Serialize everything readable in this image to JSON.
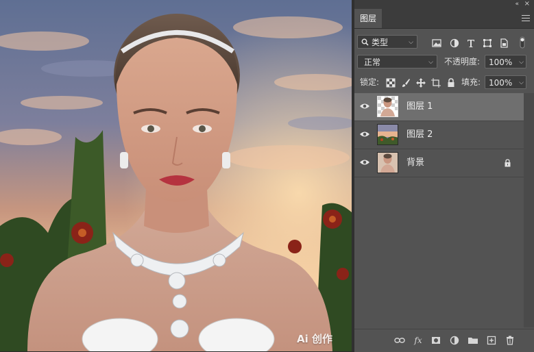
{
  "canvas": {
    "watermark": "Ai 创作"
  },
  "panel": {
    "window_controls": {
      "collapse": "«",
      "close": "×"
    },
    "tab_label": "图层",
    "filter": {
      "search_icon": "search-icon",
      "kind_value": "类型"
    },
    "filter_icons": [
      "image-filter-icon",
      "adjustment-filter-icon",
      "text-filter-icon",
      "shape-filter-icon",
      "smartobject-filter-icon"
    ],
    "blend_mode": "正常",
    "opacity": {
      "label": "不透明度:",
      "value": "100%"
    },
    "lock": {
      "label": "锁定:",
      "icons": [
        "lock-transparent-icon",
        "lock-image-icon",
        "lock-position-icon",
        "lock-artboard-icon",
        "lock-all-icon"
      ]
    },
    "fill": {
      "label": "填充:",
      "value": "100%"
    },
    "layers": [
      {
        "name": "图层 1",
        "visible": true,
        "selected": true,
        "locked": false
      },
      {
        "name": "图层 2",
        "visible": true,
        "selected": false,
        "locked": false
      },
      {
        "name": "背景",
        "visible": true,
        "selected": false,
        "locked": true
      }
    ],
    "bottom_icons": {
      "link": "⊖",
      "fx": "fx",
      "new_fill": "◐"
    }
  }
}
